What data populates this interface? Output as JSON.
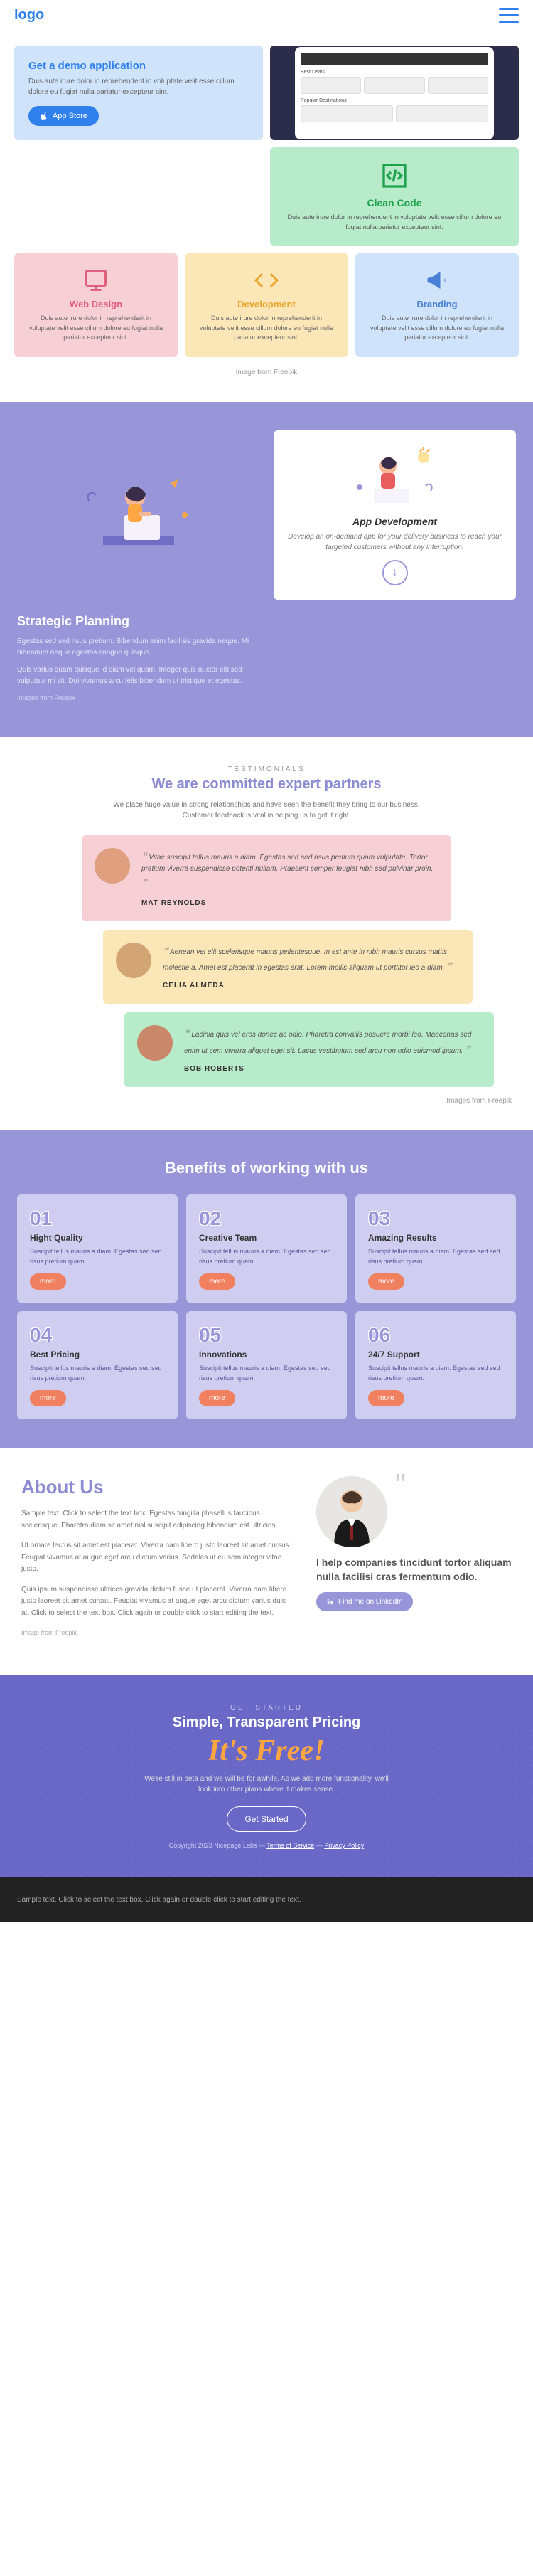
{
  "header": {
    "logo": "logo"
  },
  "hero": {
    "demo": {
      "title": "Get a demo application",
      "desc": "Duis aute irure dolor in reprehenderit in voluptate velit esse cillum dolore eu fugiat nulla pariatur excepteur sint.",
      "button": "App Store"
    },
    "phone": {
      "label1": "Best Deals",
      "label2": "Popular Destinations"
    },
    "clean": {
      "title": "Clean Code",
      "desc": "Duis aute irure dolor in reprehenderit in voluptate velit esse cillum dolore eu fugiat nulla pariatur excepteur sint."
    }
  },
  "trio": [
    {
      "title": "Web Design",
      "desc": "Duis aute irure dolor in reprehenderit in voluptate velit esse cillum dolore eu fugiat nulla pariatur excepteur sint."
    },
    {
      "title": "Development",
      "desc": "Duis aute irure dolor in reprehenderit in voluptate velit esse cillum dolore eu fugiat nulla pariatur excepteur sint."
    },
    {
      "title": "Branding",
      "desc": "Duis aute irure dolor in reprehenderit in voluptate velit esse cillum dolore eu fugiat nulla pariatur excepteur sint."
    }
  ],
  "image_credit": "Image from Freepik",
  "images_credit": "Images from Freepik",
  "strategic": {
    "title": "Strategic Planning",
    "p1": "Egestas sed sed risus pretium. Bibendum enim facilisis gravida neque. Mi bibendum neque egestas congue quisque.",
    "p2": "Quis varius quam quisque id diam vel quam. Integer quis auctor elit sed vulputate mi sit. Dui vivamus arcu felis bibendum ut tristique et egestas.",
    "app": {
      "title": "App Development",
      "desc": "Develop an on-demand app for your delivery business to reach your targeted customers without any interruption."
    }
  },
  "testimonials": {
    "tag": "TESTIMONIALS",
    "title": "We are committed expert partners",
    "sub": "We place huge value in strong relationships and have seen the benefit they bring to our business. Customer feedback is vital in helping us to get it right.",
    "items": [
      {
        "quote": "Vitae suscipit tellus mauris a diam. Egestas sed sed risus pretium quam vulputate. Tortor pretium viverra suspendisse potenti nullam. Praesent semper feugiat nibh sed pulvinar proin.",
        "name": "MAT REYNOLDS"
      },
      {
        "quote": "Aenean vel elit scelerisque mauris pellentesque. In est ante in nibh mauris cursus mattis molestie a. Amet est placerat in egestas erat. Lorem mollis aliquam ut porttitor leo a diam.",
        "name": "CELIA ALMEDA"
      },
      {
        "quote": "Lacinia quis vel eros donec ac odio. Pharetra convallis posuere morbi leo. Maecenas sed enim ut sem viverra aliquet eget sit. Lacus vestibulum sed arcu non odio euismod ipsum.",
        "name": "BOB ROBERTS"
      }
    ]
  },
  "benefits": {
    "title": "Benefits of working with us",
    "more": "more",
    "items": [
      {
        "num": "01",
        "title": "Hight Quality",
        "desc": "Suscipit tellus mauris a diam. Egestas sed sed risus pretium quam."
      },
      {
        "num": "02",
        "title": "Creative Team",
        "desc": "Suscipit tellus mauris a diam. Egestas sed sed risus pretium quam."
      },
      {
        "num": "03",
        "title": "Amazing Results",
        "desc": "Suscipit tellus mauris a diam. Egestas sed sed risus pretium quam."
      },
      {
        "num": "04",
        "title": "Best Pricing",
        "desc": "Suscipit tellus mauris a diam. Egestas sed sed risus pretium quam."
      },
      {
        "num": "05",
        "title": "Innovations",
        "desc": "Suscipit tellus mauris a diam. Egestas sed sed risus pretium quam."
      },
      {
        "num": "06",
        "title": "24/7 Support",
        "desc": "Suscipit tellus mauris a diam. Egestas sed sed risus pretium quam."
      }
    ]
  },
  "about": {
    "title": "About Us",
    "p1": "Sample text. Click to select the text box. Egestas fringilla phasellus faucibus scelerisque. Pharetra diam sit amet nisl suscipit adipiscing bibendum est ultricies.",
    "p2": "Ut ornare lectus sit amet est placerat. Viverra nam libero justo laoreet sit amet cursus. Feugiat vivamus at augue eget arcu dictum varius. Sodales ut eu sem integer vitae justo.",
    "p3": "Quis ipsum suspendisse ultrices gravida dictum fusce ut placerat. Viverra nam libero justo laoreet sit amet cursus. Feugiat vivamus at augue eget arcu dictum varius duis at. Click to select the text box. Click again or double click to start editing the text.",
    "quote": "I help companies tincidunt tortor aliquam nulla facilisi cras fermentum odio.",
    "linkedin": "Find me on LinkedIn"
  },
  "pricing": {
    "tag": "GET STARTED",
    "heading": "Simple, Transparent Pricing",
    "free": "It's Free!",
    "desc": "We're still in beta and we will be for awhile. As we add more functionality, we'll look into other plans where it makes sense.",
    "button": "Get Started",
    "copyright": "Copyright 2023 Nicepage Labs",
    "terms": "Terms of Service",
    "privacy": "Privacy Policy"
  },
  "footer": {
    "text": "Sample text. Click to select the text box. Click again or double click to start editing the text."
  }
}
